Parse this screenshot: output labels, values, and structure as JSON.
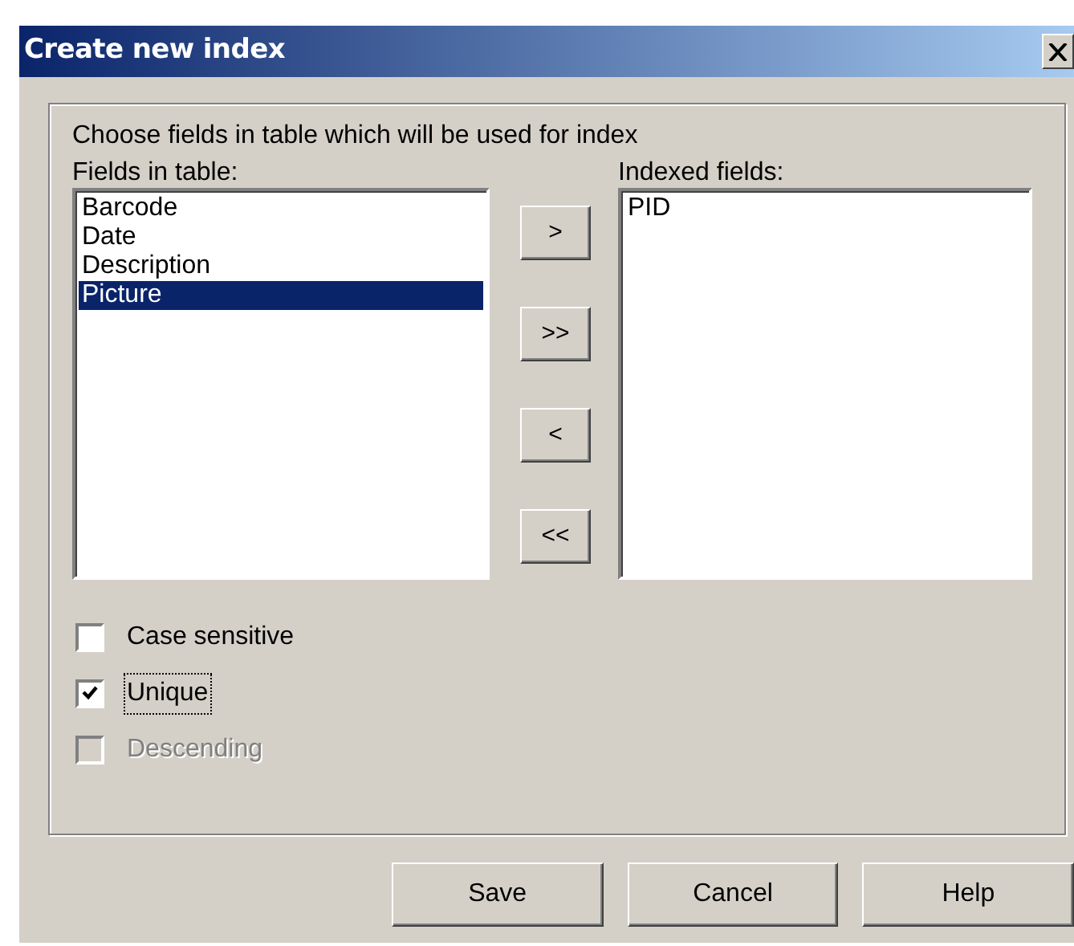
{
  "window": {
    "title": "Create new index"
  },
  "instruction": "Choose fields in table which will be used for index",
  "fields_in_table": {
    "label": "Fields in table:",
    "items": [
      {
        "text": "Barcode",
        "selected": false
      },
      {
        "text": "Date",
        "selected": false
      },
      {
        "text": "Description",
        "selected": false
      },
      {
        "text": "Picture",
        "selected": true
      }
    ]
  },
  "move_buttons": [
    ">",
    ">>",
    "<",
    "<<"
  ],
  "indexed_fields": {
    "label": "Indexed fields:",
    "items": [
      {
        "text": "PID",
        "selected": false
      }
    ]
  },
  "options": [
    {
      "label": "Case sensitive",
      "checked": false,
      "disabled": false,
      "focused": false
    },
    {
      "label": "Unique",
      "checked": true,
      "disabled": false,
      "focused": true
    },
    {
      "label": "Descending",
      "checked": false,
      "disabled": true,
      "focused": false
    }
  ],
  "buttons": [
    "Save",
    "Cancel",
    "Help"
  ]
}
